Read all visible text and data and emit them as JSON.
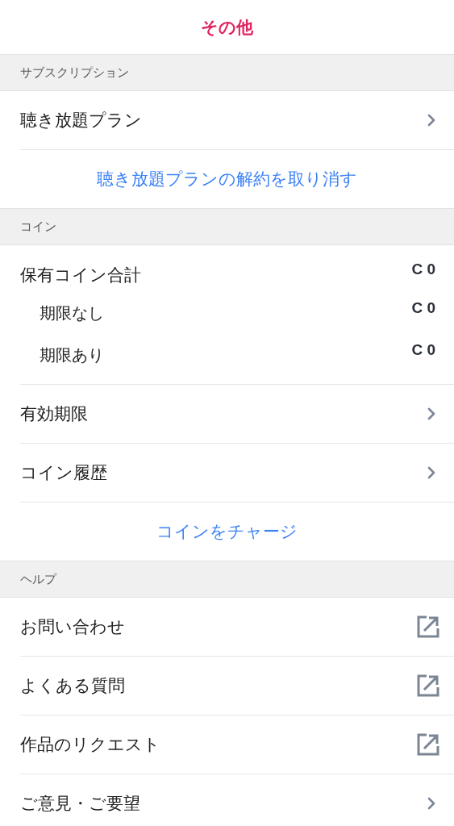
{
  "title": "その他",
  "sections": [
    {
      "header": "サブスクリプション",
      "items": [
        {
          "kind": "nav",
          "label": "聴き放題プラン"
        },
        {
          "kind": "action",
          "label": "聴き放題プランの解約を取り消す"
        }
      ]
    },
    {
      "header": "コイン",
      "items": [
        {
          "kind": "coins",
          "label": "保有コイン合計",
          "value": "C 0",
          "breakdown": [
            {
              "label": "期限なし",
              "value": "C 0"
            },
            {
              "label": "期限あり",
              "value": "C 0"
            }
          ]
        },
        {
          "kind": "nav",
          "label": "有効期限"
        },
        {
          "kind": "nav",
          "label": "コイン履歴"
        },
        {
          "kind": "action",
          "label": "コインをチャージ"
        }
      ]
    },
    {
      "header": "ヘルプ",
      "items": [
        {
          "kind": "external",
          "label": "お問い合わせ"
        },
        {
          "kind": "external",
          "label": "よくある質問"
        },
        {
          "kind": "external",
          "label": "作品のリクエスト"
        },
        {
          "kind": "nav",
          "label": "ご意見・ご要望"
        }
      ]
    }
  ]
}
